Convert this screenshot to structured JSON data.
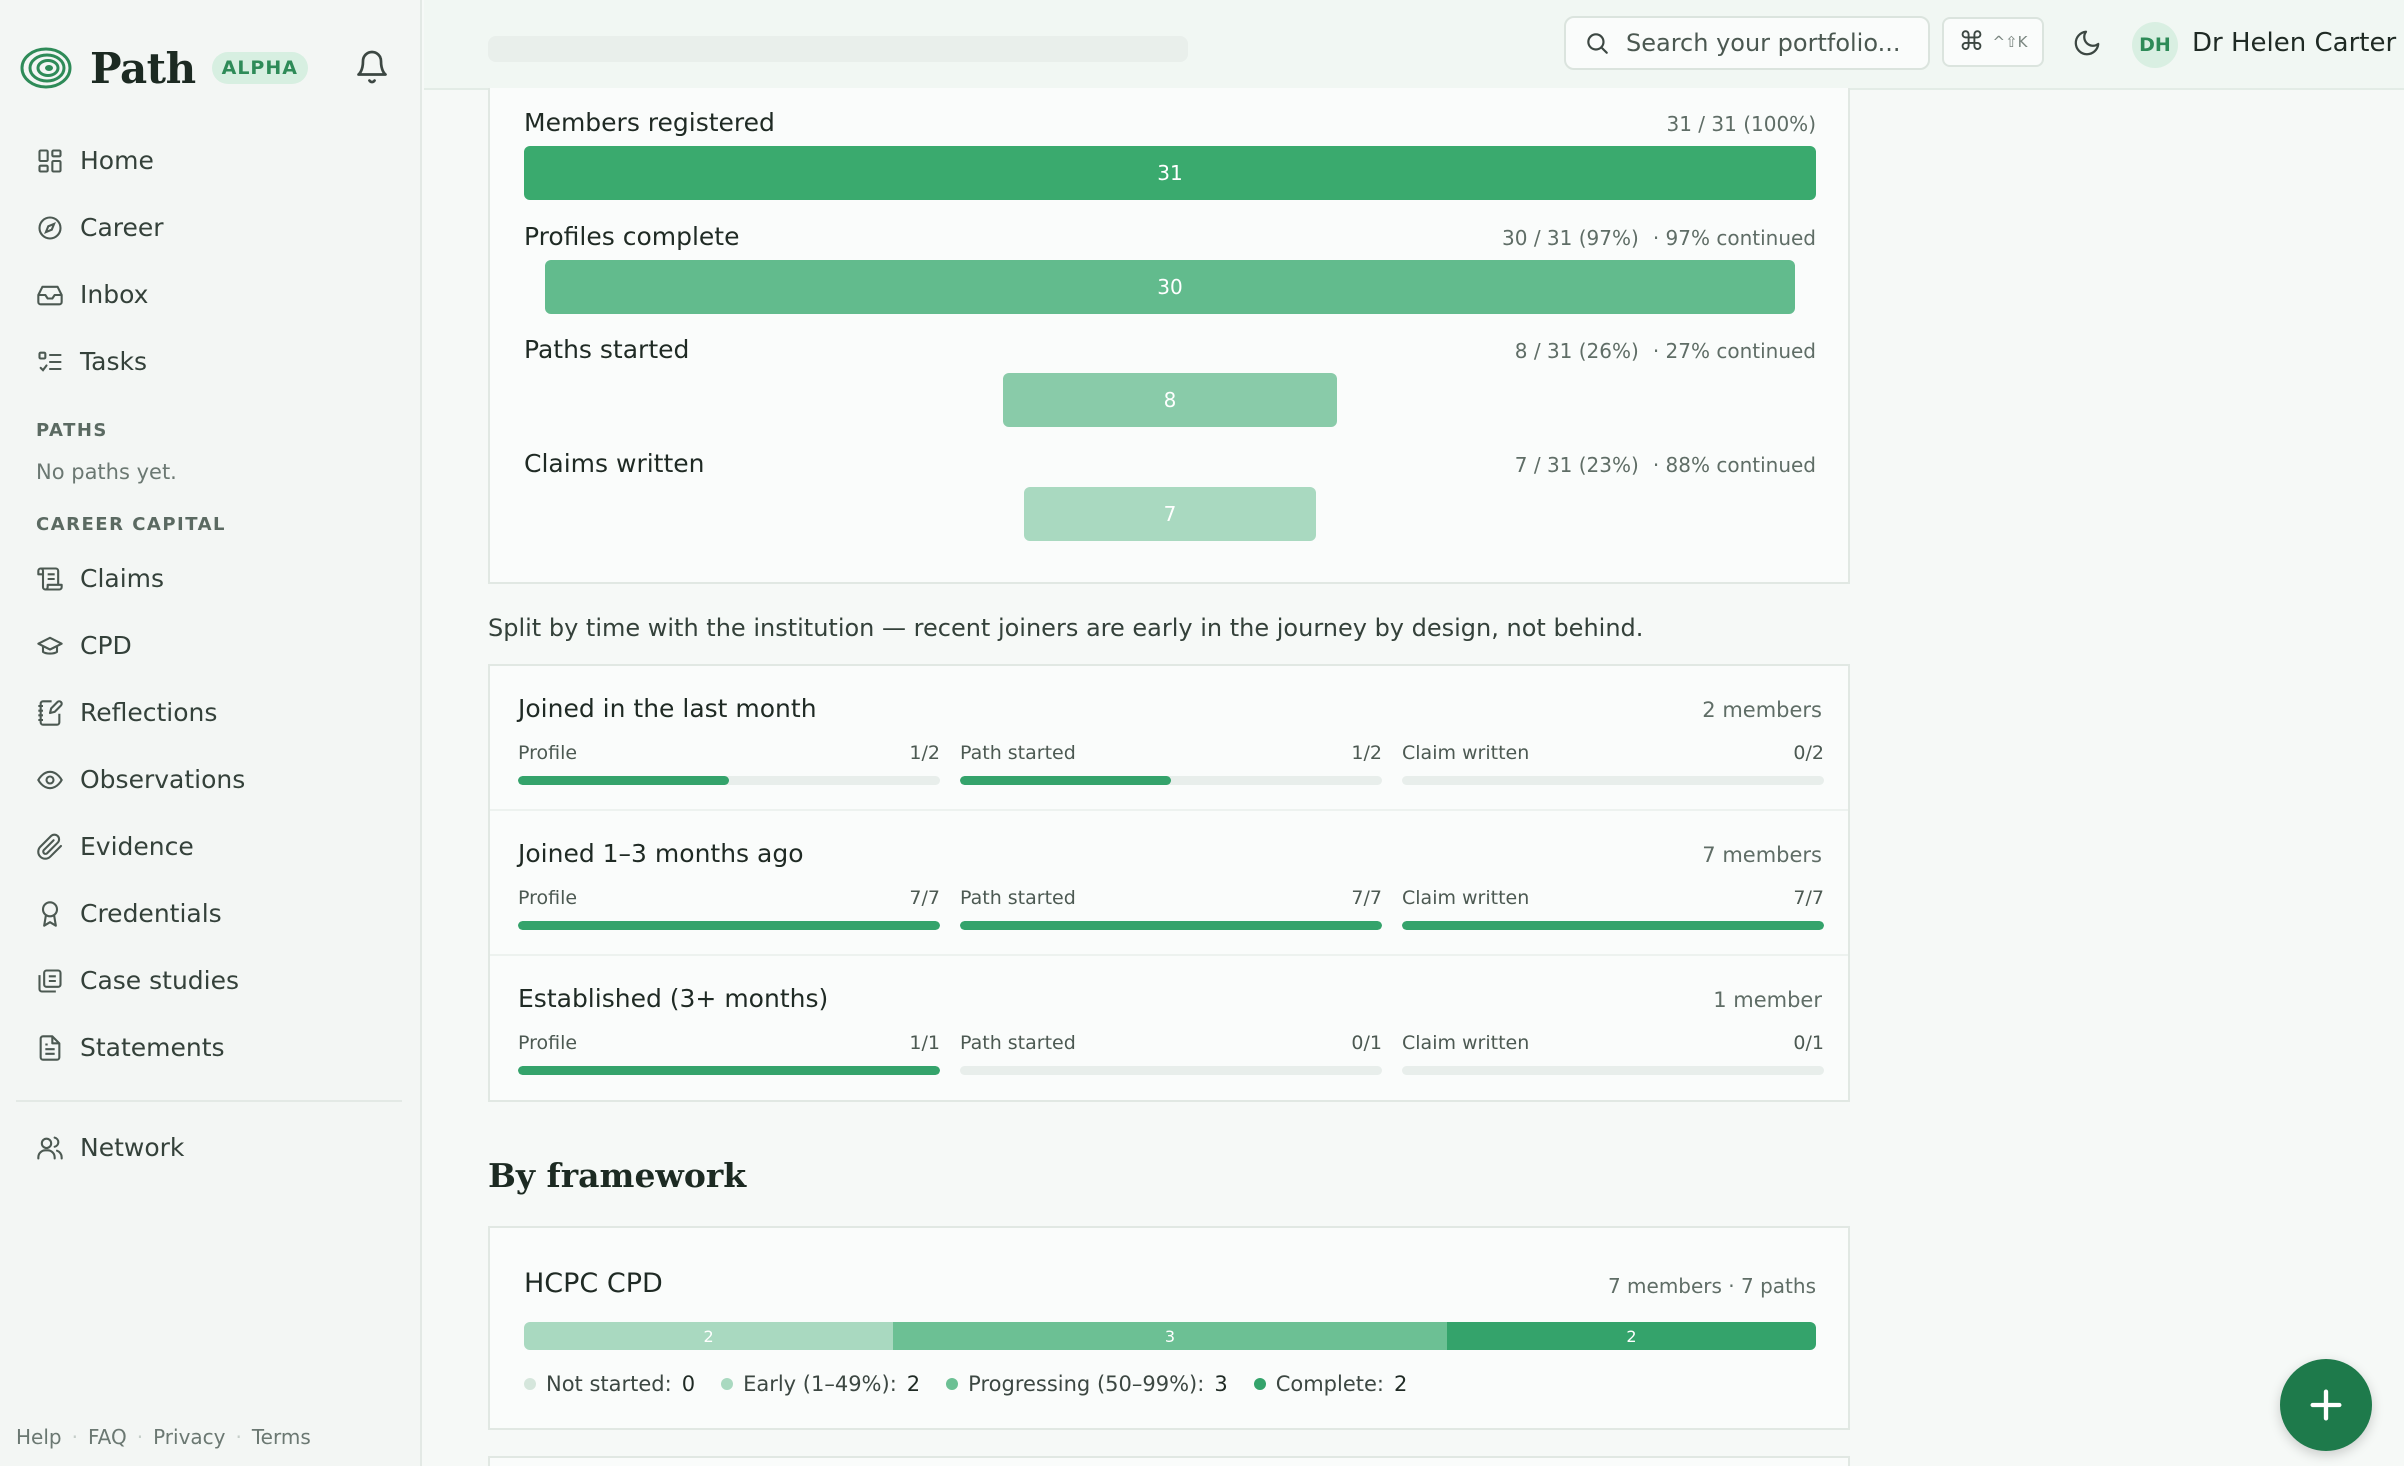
{
  "brand": {
    "name": "Path",
    "badge": "ALPHA"
  },
  "sidebar": {
    "main_items": [
      {
        "label": "Home",
        "icon": "home-icon"
      },
      {
        "label": "Career",
        "icon": "compass-icon"
      },
      {
        "label": "Inbox",
        "icon": "inbox-icon"
      },
      {
        "label": "Tasks",
        "icon": "tasks-icon"
      }
    ],
    "paths_heading": "PATHS",
    "paths_empty": "No paths yet.",
    "capital_heading": "CAREER CAPITAL",
    "capital_items": [
      {
        "label": "Claims",
        "icon": "scroll-icon"
      },
      {
        "label": "CPD",
        "icon": "graduation-cap-icon"
      },
      {
        "label": "Reflections",
        "icon": "notebook-pen-icon"
      },
      {
        "label": "Observations",
        "icon": "eye-icon"
      },
      {
        "label": "Evidence",
        "icon": "paperclip-icon"
      },
      {
        "label": "Credentials",
        "icon": "award-icon"
      },
      {
        "label": "Case studies",
        "icon": "library-icon"
      },
      {
        "label": "Statements",
        "icon": "document-icon"
      }
    ],
    "network": {
      "label": "Network",
      "icon": "users-icon"
    },
    "footer": [
      "Help",
      "FAQ",
      "Privacy",
      "Terms"
    ]
  },
  "header": {
    "search_placeholder": "Search your portfolio...",
    "shortcut_symbol": "⌘",
    "shortcut_keys": "^⇧K",
    "user_initials": "DH",
    "user_name": "Dr Helen Carter"
  },
  "funnel": {
    "total": 31,
    "rows": [
      {
        "label": "Members registered",
        "value": 31,
        "stat": "31 / 31 (100%)",
        "continued": "",
        "color": "#3aaa6e"
      },
      {
        "label": "Profiles complete",
        "value": 30,
        "stat": "30 / 31 (97%)",
        "continued": "· 97% continued",
        "color": "#62bb8d"
      },
      {
        "label": "Paths started",
        "value": 8,
        "stat": "8 / 31 (26%)",
        "continued": "· 27% continued",
        "color": "#89cba9"
      },
      {
        "label": "Claims written",
        "value": 7,
        "stat": "7 / 31 (23%)",
        "continued": "· 88% continued",
        "color": "#a9d9c0"
      }
    ]
  },
  "split_note": "Split by time with the institution — recent joiners are early in the journey by design, not behind.",
  "cohorts": [
    {
      "title": "Joined in the last month",
      "count": "2 members",
      "metrics": [
        {
          "label": "Profile",
          "value": "1/2",
          "fraction": 0.5
        },
        {
          "label": "Path started",
          "value": "1/2",
          "fraction": 0.5
        },
        {
          "label": "Claim written",
          "value": "0/2",
          "fraction": 0
        }
      ]
    },
    {
      "title": "Joined 1–3 months ago",
      "count": "7 members",
      "metrics": [
        {
          "label": "Profile",
          "value": "7/7",
          "fraction": 1
        },
        {
          "label": "Path started",
          "value": "7/7",
          "fraction": 1
        },
        {
          "label": "Claim written",
          "value": "7/7",
          "fraction": 1
        }
      ]
    },
    {
      "title": "Established (3+ months)",
      "count": "1 member",
      "metrics": [
        {
          "label": "Profile",
          "value": "1/1",
          "fraction": 1
        },
        {
          "label": "Path started",
          "value": "0/1",
          "fraction": 0
        },
        {
          "label": "Claim written",
          "value": "0/1",
          "fraction": 0
        }
      ]
    }
  ],
  "framework_heading": "By framework",
  "framework": {
    "name": "HCPC CPD",
    "meta": "7 members · 7 paths",
    "segments": [
      {
        "label": "Not started:",
        "value": 0,
        "color": "#d5e6dc"
      },
      {
        "label": "Early (1–49%):",
        "value": 2,
        "color": "#a9d9c0"
      },
      {
        "label": "Progressing (50–99%):",
        "value": 3,
        "color": "#6cc094"
      },
      {
        "label": "Complete:",
        "value": 2,
        "color": "#34a36b"
      }
    ]
  },
  "colors": {
    "accent": "#34a36b",
    "fab": "#1e7a4b"
  }
}
